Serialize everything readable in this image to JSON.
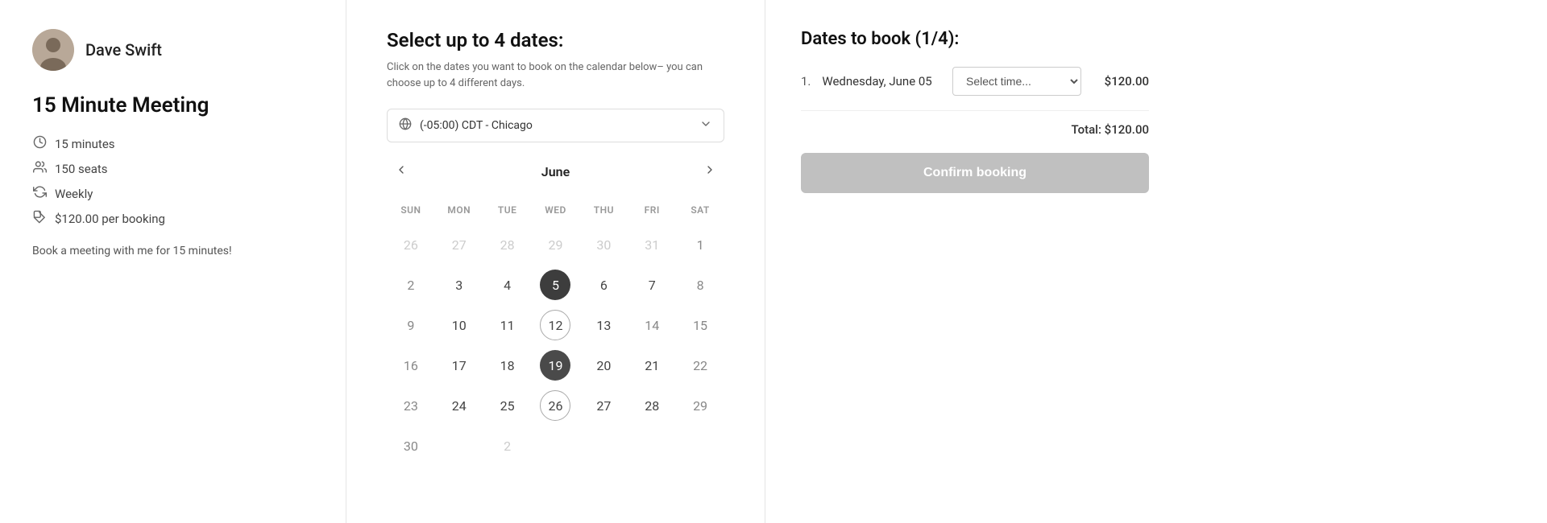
{
  "left": {
    "profile_name": "Dave Swift",
    "meeting_title": "15 Minute Meeting",
    "meta": [
      {
        "id": "duration",
        "icon": "clock",
        "text": "15 minutes"
      },
      {
        "id": "seats",
        "icon": "users",
        "text": "150 seats"
      },
      {
        "id": "recurrence",
        "icon": "recycle",
        "text": "Weekly"
      },
      {
        "id": "price",
        "icon": "price-tag",
        "text": "$120.00 per booking"
      }
    ],
    "description": "Book a meeting with me for 15 minutes!"
  },
  "center": {
    "title": "Select up to 4 dates:",
    "subtitle": "Click on the dates you want to book on the calendar below– you can choose up to 4 different days.",
    "timezone": "(-05:00) CDT - Chicago",
    "calendar": {
      "month": "June",
      "day_headers": [
        "SUN",
        "MON",
        "TUE",
        "WED",
        "THU",
        "FRI",
        "SAT"
      ],
      "weeks": [
        [
          {
            "day": "26",
            "type": "prev-month"
          },
          {
            "day": "27",
            "type": "prev-month"
          },
          {
            "day": "28",
            "type": "prev-month"
          },
          {
            "day": "29",
            "type": "prev-month"
          },
          {
            "day": "30",
            "type": "prev-month"
          },
          {
            "day": "31",
            "type": "prev-month"
          },
          {
            "day": "1",
            "type": "available"
          }
        ],
        [
          {
            "day": "2",
            "type": "available"
          },
          {
            "day": "3",
            "type": "available-circle"
          },
          {
            "day": "4",
            "type": "available-circle"
          },
          {
            "day": "5",
            "type": "selected-dark"
          },
          {
            "day": "6",
            "type": "available-circle"
          },
          {
            "day": "7",
            "type": "available-circle"
          },
          {
            "day": "8",
            "type": "available"
          }
        ],
        [
          {
            "day": "9",
            "type": "available"
          },
          {
            "day": "10",
            "type": "available-circle"
          },
          {
            "day": "11",
            "type": "available-circle"
          },
          {
            "day": "12",
            "type": "outlined"
          },
          {
            "day": "13",
            "type": "available-circle"
          },
          {
            "day": "14",
            "type": "available"
          },
          {
            "day": "15",
            "type": "available"
          }
        ],
        [
          {
            "day": "16",
            "type": "available"
          },
          {
            "day": "17",
            "type": "available-circle"
          },
          {
            "day": "18",
            "type": "available-circle"
          },
          {
            "day": "19",
            "type": "selected-medium"
          },
          {
            "day": "20",
            "type": "available-circle"
          },
          {
            "day": "21",
            "type": "available-circle"
          },
          {
            "day": "22",
            "type": "available"
          }
        ],
        [
          {
            "day": "23",
            "type": "available"
          },
          {
            "day": "24",
            "type": "available-circle"
          },
          {
            "day": "25",
            "type": "available-circle"
          },
          {
            "day": "26",
            "type": "outlined"
          },
          {
            "day": "27",
            "type": "available-circle"
          },
          {
            "day": "28",
            "type": "available-circle"
          },
          {
            "day": "29",
            "type": "available"
          }
        ],
        [
          {
            "day": "30",
            "type": "available"
          },
          {
            "day": "",
            "type": "empty"
          },
          {
            "day": "2",
            "type": "next-month"
          },
          {
            "day": "",
            "type": "empty"
          },
          {
            "day": "",
            "type": "empty"
          },
          {
            "day": "",
            "type": "empty"
          },
          {
            "day": "",
            "type": "empty"
          }
        ]
      ]
    }
  },
  "right": {
    "title": "Dates to book (1/4):",
    "booking_items": [
      {
        "index": "1.",
        "date": "Wednesday, June 05",
        "time_placeholder": "Select time...",
        "price": "$120.00"
      }
    ],
    "total_label": "Total: $120.00",
    "confirm_btn_label": "Confirm booking"
  }
}
